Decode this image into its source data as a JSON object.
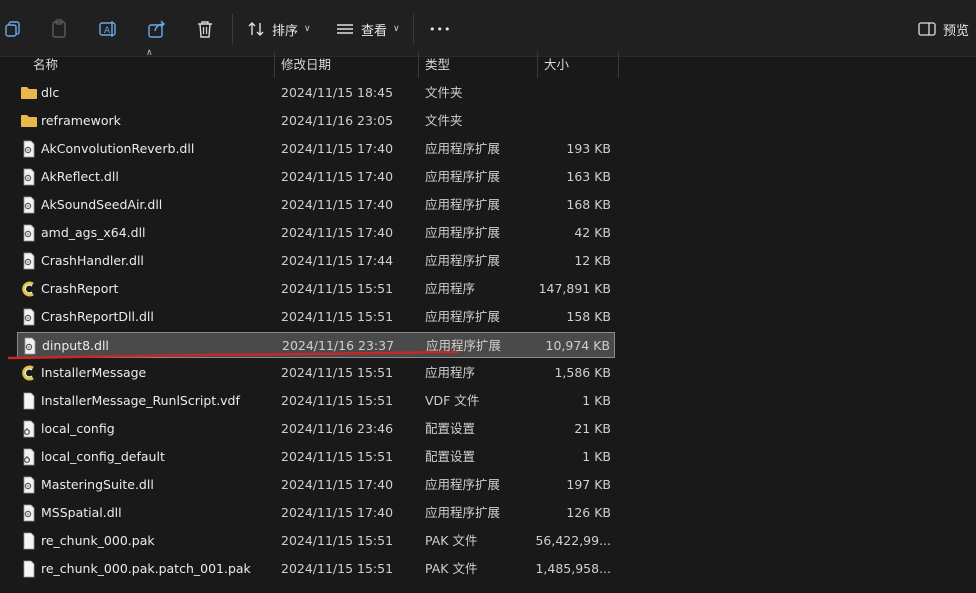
{
  "toolbar": {
    "sort_label": "排序",
    "view_label": "查看",
    "more_label": "•••",
    "preview_label": "预览"
  },
  "columns": {
    "name": "名称",
    "date": "修改日期",
    "type": "类型",
    "size": "大小"
  },
  "files": [
    {
      "name": "dlc",
      "date": "2024/11/15 18:45",
      "type": "文件夹",
      "size": "",
      "icon": "folder-icon"
    },
    {
      "name": "reframework",
      "date": "2024/11/16 23:05",
      "type": "文件夹",
      "size": "",
      "icon": "folder-icon"
    },
    {
      "name": "AkConvolutionReverb.dll",
      "date": "2024/11/15 17:40",
      "type": "应用程序扩展",
      "size": "193 KB",
      "icon": "dll-icon"
    },
    {
      "name": "AkReflect.dll",
      "date": "2024/11/15 17:40",
      "type": "应用程序扩展",
      "size": "163 KB",
      "icon": "dll-icon"
    },
    {
      "name": "AkSoundSeedAir.dll",
      "date": "2024/11/15 17:40",
      "type": "应用程序扩展",
      "size": "168 KB",
      "icon": "dll-icon"
    },
    {
      "name": "amd_ags_x64.dll",
      "date": "2024/11/15 17:40",
      "type": "应用程序扩展",
      "size": "42 KB",
      "icon": "dll-icon"
    },
    {
      "name": "CrashHandler.dll",
      "date": "2024/11/15 17:44",
      "type": "应用程序扩展",
      "size": "12 KB",
      "icon": "dll-icon"
    },
    {
      "name": "CrashReport",
      "date": "2024/11/15 15:51",
      "type": "应用程序",
      "size": "147,891 KB",
      "icon": "app-icon"
    },
    {
      "name": "CrashReportDll.dll",
      "date": "2024/11/15 15:51",
      "type": "应用程序扩展",
      "size": "158 KB",
      "icon": "dll-icon"
    },
    {
      "name": "dinput8.dll",
      "date": "2024/11/16 23:37",
      "type": "应用程序扩展",
      "size": "10,974 KB",
      "icon": "dll-icon",
      "selected": true
    },
    {
      "name": "InstallerMessage",
      "date": "2024/11/15 15:51",
      "type": "应用程序",
      "size": "1,586 KB",
      "icon": "app-icon"
    },
    {
      "name": "InstallerMessage_RunlScript.vdf",
      "date": "2024/11/15 15:51",
      "type": "VDF 文件",
      "size": "1 KB",
      "icon": "file-icon"
    },
    {
      "name": "local_config",
      "date": "2024/11/16 23:46",
      "type": "配置设置",
      "size": "21 KB",
      "icon": "config-icon"
    },
    {
      "name": "local_config_default",
      "date": "2024/11/15 15:51",
      "type": "配置设置",
      "size": "1 KB",
      "icon": "config-icon"
    },
    {
      "name": "MasteringSuite.dll",
      "date": "2024/11/15 17:40",
      "type": "应用程序扩展",
      "size": "197 KB",
      "icon": "dll-icon"
    },
    {
      "name": "MSSpatial.dll",
      "date": "2024/11/15 17:40",
      "type": "应用程序扩展",
      "size": "126 KB",
      "icon": "dll-icon"
    },
    {
      "name": "re_chunk_000.pak",
      "date": "2024/11/15 15:51",
      "type": "PAK 文件",
      "size": "56,422,99...",
      "icon": "file-icon"
    },
    {
      "name": "re_chunk_000.pak.patch_001.pak",
      "date": "2024/11/15 15:51",
      "type": "PAK 文件",
      "size": "1,485,958...",
      "icon": "file-icon"
    }
  ],
  "colors": {
    "background": "#191919",
    "folder": "#e9b849",
    "selection": "#4a4a4a",
    "annotation": "#c4292a"
  }
}
